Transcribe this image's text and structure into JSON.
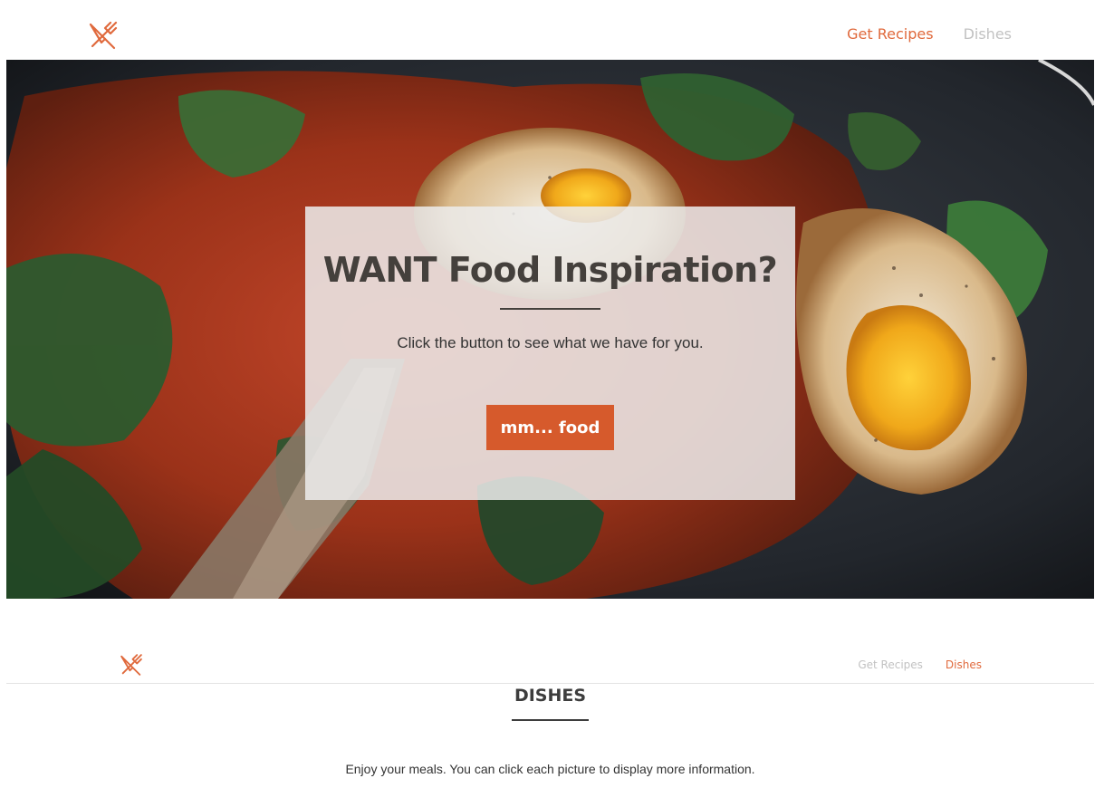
{
  "brand": {
    "logo_icon": "crossed-fork-knife-icon",
    "accent_color": "#e06a3d",
    "button_color": "#d65a2c"
  },
  "top_nav": {
    "items": [
      {
        "label": "Get Recipes",
        "active": true
      },
      {
        "label": "Dishes",
        "active": false
      }
    ]
  },
  "hero": {
    "title": "WANT Food Inspiration?",
    "subtitle": "Click the button to see what we have for you.",
    "button_label": "mm... food"
  },
  "sub_nav": {
    "items": [
      {
        "label": "Get Recipes",
        "active": false
      },
      {
        "label": "Dishes",
        "active": true
      }
    ]
  },
  "dishes_section": {
    "title": "DISHES",
    "description": "Enjoy your meals. You can click each picture to display more information."
  }
}
